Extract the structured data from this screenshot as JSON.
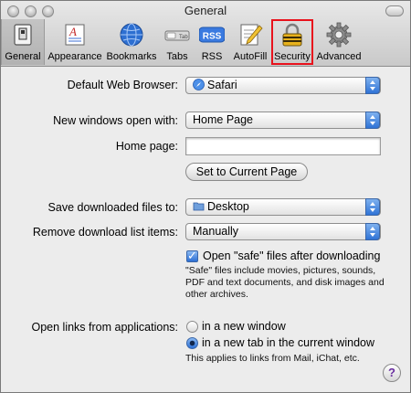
{
  "window": {
    "title": "General"
  },
  "toolbar": {
    "items": [
      {
        "label": "General",
        "icon": "general-switch-icon"
      },
      {
        "label": "Appearance",
        "icon": "appearance-font-icon"
      },
      {
        "label": "Bookmarks",
        "icon": "bookmarks-globe-icon"
      },
      {
        "label": "Tabs",
        "icon": "tabs-icon"
      },
      {
        "label": "RSS",
        "icon": "rss-icon"
      },
      {
        "label": "AutoFill",
        "icon": "autofill-pencil-icon"
      },
      {
        "label": "Security",
        "icon": "security-padlock-icon"
      },
      {
        "label": "Advanced",
        "icon": "advanced-gear-icon"
      }
    ],
    "selected": "General",
    "highlighted": "Security",
    "rss_badge": "RSS",
    "tabs_badge": "Tab",
    "appearance_glyph": "A",
    "highlight_color": "#e8121c"
  },
  "form": {
    "default_browser": {
      "label": "Default Web Browser:",
      "value": "Safari"
    },
    "new_windows": {
      "label": "New windows open with:",
      "value": "Home Page"
    },
    "home_page": {
      "label": "Home page:",
      "value": ""
    },
    "set_current_button": "Set to Current Page",
    "save_downloads": {
      "label": "Save downloaded files to:",
      "value": "Desktop"
    },
    "remove_download": {
      "label": "Remove download list items:",
      "value": "Manually"
    },
    "open_safe": {
      "label": "Open \"safe\" files after downloading",
      "checked": true,
      "help_text": "\"Safe\" files include movies, pictures, sounds, PDF and text documents, and disk images and other archives."
    },
    "open_links": {
      "label": "Open links from applications:",
      "options": [
        "in a new window",
        "in a new tab in the current window"
      ],
      "selected_index": 1,
      "note": "This applies to links from Mail, iChat, etc."
    },
    "help_button": "?"
  }
}
